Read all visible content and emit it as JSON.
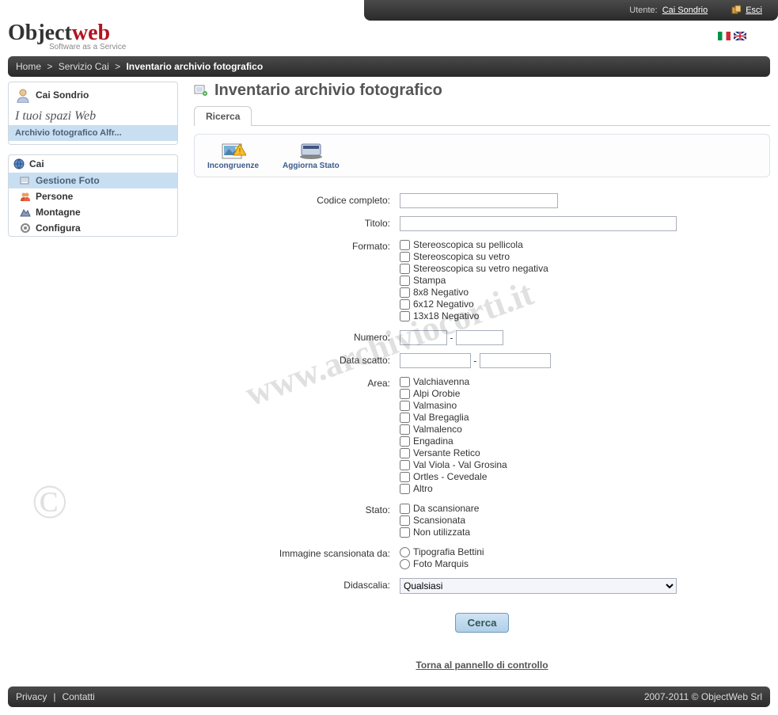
{
  "topbar": {
    "user_label": "Utente:",
    "user_name": "Cai Sondrio",
    "logout": "Esci"
  },
  "logo": {
    "part1": "Object",
    "part2": "web",
    "tagline": "Software as a Service"
  },
  "breadcrumb": {
    "home": "Home",
    "service": "Servizio Cai",
    "current": "Inventario archivio fotografico"
  },
  "sidebar": {
    "user_name": "Cai Sondrio",
    "spazi": "I tuoi spazi Web",
    "archive": "Archivio fotografico Alfr...",
    "nav_title": "Cai",
    "items": [
      {
        "label": "Gestione Foto",
        "active": true
      },
      {
        "label": "Persone",
        "active": false
      },
      {
        "label": "Montagne",
        "active": false
      },
      {
        "label": "Configura",
        "active": false
      }
    ]
  },
  "page": {
    "title": "Inventario archivio fotografico",
    "tab": "Ricerca",
    "toolbar": {
      "incongruenze": "Incongruenze",
      "aggiorna": "Aggiorna Stato"
    }
  },
  "form": {
    "labels": {
      "codice": "Codice completo:",
      "titolo": "Titolo:",
      "formato": "Formato:",
      "numero": "Numero:",
      "data_scatto": "Data scatto:",
      "area": "Area:",
      "stato": "Stato:",
      "scansionata_da": "Immagine scansionata da:",
      "didascalia": "Didascalia:"
    },
    "numero_sep": "-",
    "data_sep": "-",
    "formato_options": [
      "Stereoscopica su pellicola",
      "Stereoscopica su vetro",
      "Stereoscopica su vetro negativa",
      "Stampa",
      "8x8 Negativo",
      "6x12 Negativo",
      "13x18 Negativo"
    ],
    "area_options": [
      "Valchiavenna",
      "Alpi Orobie",
      "Valmasino",
      "Val Bregaglia",
      "Valmalenco",
      "Engadina",
      "Versante Retico",
      "Val Viola - Val Grosina",
      "Ortles - Cevedale",
      "Altro"
    ],
    "stato_options": [
      "Da scansionare",
      "Scansionata",
      "Non utilizzata"
    ],
    "scansionata_options": [
      "Tipografia Bettini",
      "Foto Marquis"
    ],
    "didascalia_selected": "Qualsiasi",
    "cerca_btn": "Cerca",
    "back_link": "Torna al pannello di controllo"
  },
  "footer": {
    "privacy": "Privacy",
    "contatti": "Contatti",
    "copyright": "2007-2011 © ObjectWeb Srl"
  },
  "watermark": "www.archiviocorti.it",
  "watermark_c": "©"
}
